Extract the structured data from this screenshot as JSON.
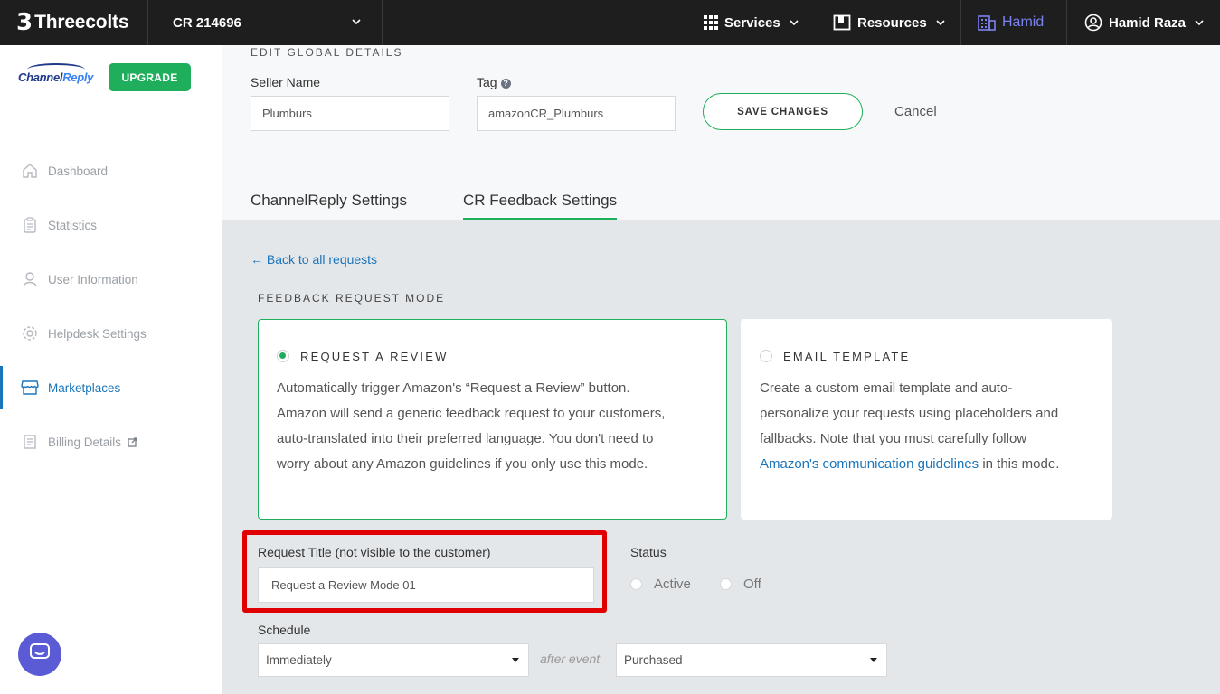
{
  "topbar": {
    "brand": "Threecolts",
    "account": "CR 214696",
    "services": "Services",
    "resources": "Resources",
    "workspace": "Hamid",
    "user": "Hamid Raza",
    "workspace_color": "#7b83f0"
  },
  "sidebar": {
    "logo_text_a": "Channel",
    "logo_text_b": "Reply",
    "upgrade": "UPGRADE",
    "items": [
      {
        "label": "Dashboard",
        "icon": "home-icon"
      },
      {
        "label": "Statistics",
        "icon": "clipboard-icon"
      },
      {
        "label": "User Information",
        "icon": "user-icon"
      },
      {
        "label": "Helpdesk Settings",
        "icon": "gear-icon"
      },
      {
        "label": "Marketplaces",
        "icon": "store-icon",
        "active": true
      },
      {
        "label": "Billing Details",
        "icon": "receipt-icon"
      }
    ]
  },
  "global": {
    "heading": "EDIT GLOBAL DETAILS",
    "seller_label": "Seller Name",
    "seller_value": "Plumburs",
    "tag_label": "Tag",
    "tag_value": "amazonCR_Plumburs",
    "save": "SAVE CHANGES",
    "cancel": "Cancel"
  },
  "tabs": [
    {
      "label": "ChannelReply Settings",
      "active": false
    },
    {
      "label": "CR Feedback Settings",
      "active": true
    }
  ],
  "feedback": {
    "back": "← Back to all requests",
    "mode_heading": "FEEDBACK REQUEST MODE",
    "modes": [
      {
        "title": "REQUEST A REVIEW",
        "selected": true,
        "lines": [
          "Automatically trigger Amazon's “Request a Review” button.",
          "Amazon will send a generic feedback request to your customers,",
          "auto-translated into their preferred language. You don't need to",
          "worry about any Amazon guidelines if you only use this mode."
        ]
      },
      {
        "title": "EMAIL TEMPLATE",
        "selected": false,
        "lines": [
          "Create a custom email template and auto-",
          "personalize your requests using placeholders and",
          "fallbacks. Note that you must carefully follow"
        ],
        "link": "Amazon's communication guidelines",
        "link_suffix": " in this mode."
      }
    ],
    "title_label": "Request Title (not visible to the customer)",
    "title_value": "Request a Review Mode 01",
    "status_label": "Status",
    "status_options": [
      "Active",
      "Off"
    ],
    "schedule_label": "Schedule",
    "schedule_value": "Immediately",
    "after_event": "after event",
    "event_value": "Purchased"
  },
  "colors": {
    "accent_green": "#1fae5b",
    "link_blue": "#1b75bb",
    "highlight_red": "#e00000"
  }
}
